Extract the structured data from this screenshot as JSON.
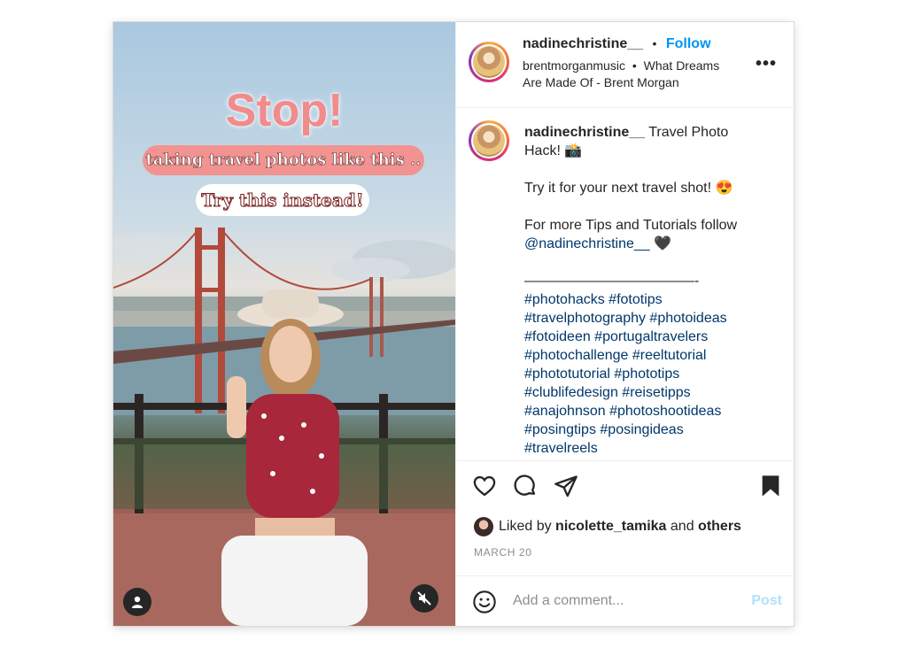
{
  "media": {
    "title": "Stop!",
    "line1": "taking travel photos like this ..",
    "line2": "Try this instead!",
    "profile_icon": "person-icon",
    "mute_icon": "speaker-muted-icon"
  },
  "header": {
    "username": "nadinechristine__",
    "separator": "•",
    "follow_label": "Follow",
    "audio_artist": "brentmorganmusic",
    "audio_sep": "•",
    "audio_title": "What Dreams Are Made Of - Brent Morgan",
    "more_label": "•••"
  },
  "caption": {
    "username": "nadinechristine__",
    "intro": "Travel Photo",
    "intro2": "Hack! 📸",
    "try_line": "Try it for your next travel shot! 😍",
    "follow_line": "For more Tips and Tutorials follow",
    "mention": "@nadinechristine__",
    "heart": "🖤",
    "divider": "————————————-",
    "hashtag_lines": [
      "#photohacks #fototips",
      "#travelphotography #photoideas",
      "#fotoideen #portugaltravelers",
      "#photochallenge #reeltutorial",
      "#phototutorial #phototips",
      "#clublifedesign #reisetipps",
      "#anajohnson #photoshootideas",
      "#posingtips #posingideas",
      "#travelreels"
    ]
  },
  "actions": {
    "icons": [
      "heart-icon",
      "comment-icon",
      "share-icon",
      "bookmark-icon"
    ]
  },
  "likes": {
    "prefix": "Liked by",
    "user": "nicolette_tamika",
    "conj": "and",
    "others": "others"
  },
  "date": "MARCH 20",
  "comment": {
    "placeholder": "Add a comment...",
    "post_label": "Post",
    "emoji_icon": "smiley-icon"
  },
  "colors": {
    "accent": "#0095f6",
    "hashtag": "#00376b",
    "pill_pink": "#f39391",
    "title_pink": "#f28b8b",
    "post_disabled": "#b2dffc"
  }
}
